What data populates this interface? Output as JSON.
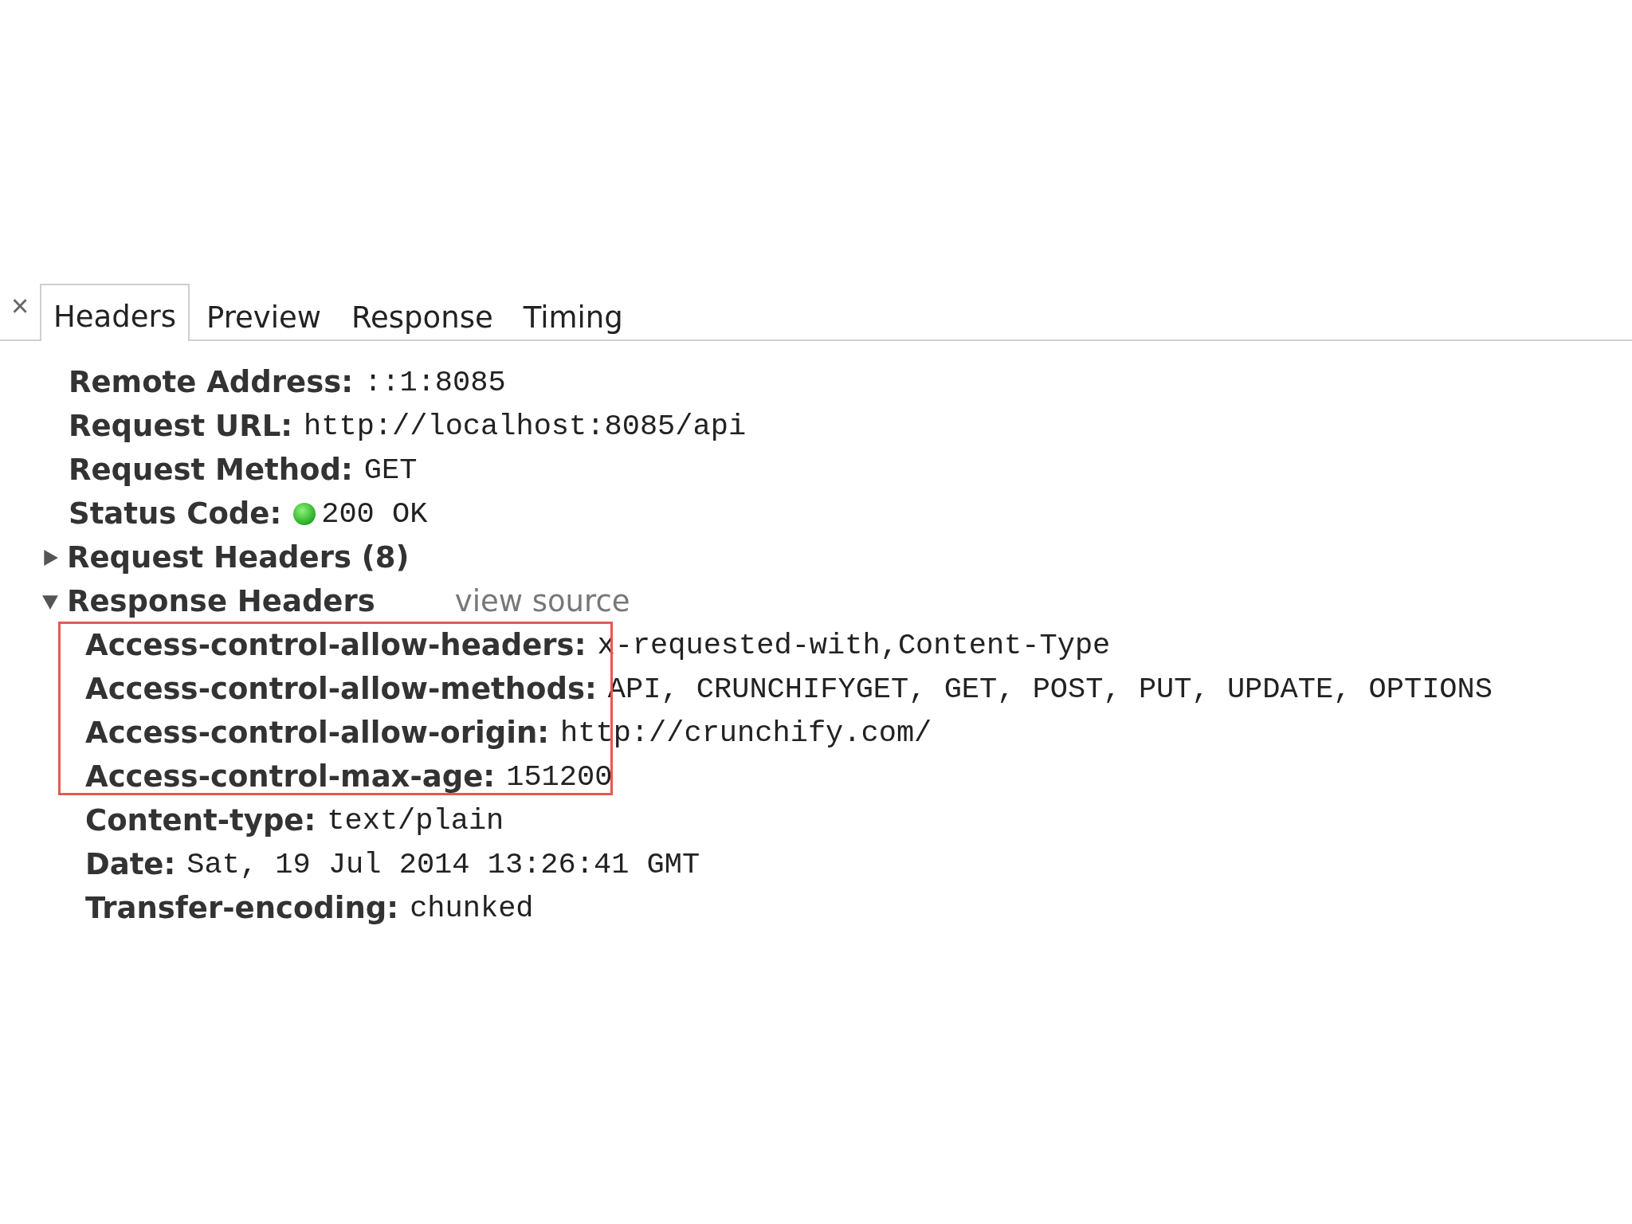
{
  "close_label": "×",
  "tabs": [
    {
      "label": "Headers",
      "selected": true
    },
    {
      "label": "Preview",
      "selected": false
    },
    {
      "label": "Response",
      "selected": false
    },
    {
      "label": "Timing",
      "selected": false
    }
  ],
  "general": [
    {
      "name": "Remote Address:",
      "value": "::1:8085",
      "kind": "text"
    },
    {
      "name": "Request URL:",
      "value": "http://localhost:8085/api",
      "kind": "text"
    },
    {
      "name": "Request Method:",
      "value": "GET",
      "kind": "text"
    },
    {
      "name": "Status Code:",
      "value": "200 OK",
      "kind": "status"
    }
  ],
  "sections": [
    {
      "title": "Request Headers (8)",
      "expanded": false
    },
    {
      "title": "Response Headers",
      "expanded": true,
      "link": "view source",
      "highlighted_headers": [
        {
          "name": "Access-control-allow-headers:",
          "value": "x-requested-with,Content-Type"
        },
        {
          "name": "Access-control-allow-methods:",
          "value": "API, CRUNCHIFYGET, GET, POST, PUT, UPDATE, OPTIONS"
        },
        {
          "name": "Access-control-allow-origin:",
          "value": "http://crunchify.com/"
        },
        {
          "name": "Access-control-max-age:",
          "value": "151200"
        }
      ],
      "headers": [
        {
          "name": "Content-type:",
          "value": "text/plain"
        },
        {
          "name": "Date:",
          "value": "Sat, 19 Jul 2014 13:26:41 GMT"
        },
        {
          "name": "Transfer-encoding:",
          "value": "chunked"
        }
      ]
    }
  ]
}
